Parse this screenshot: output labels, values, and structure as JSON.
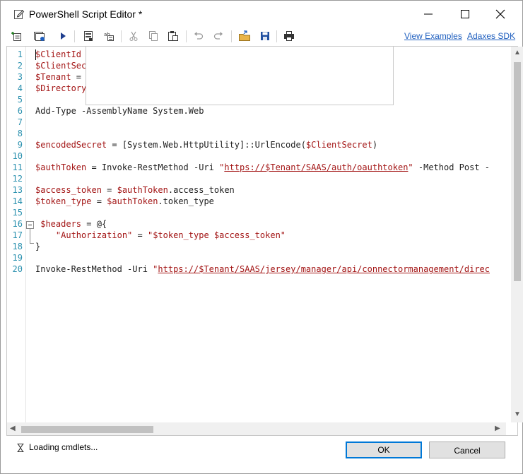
{
  "window": {
    "title": "PowerShell Script Editor *"
  },
  "toolbar": {
    "buttons": [
      {
        "icon": "insert-line-icon"
      },
      {
        "icon": "run-options-icon"
      },
      {
        "icon": "run-icon"
      },
      {
        "icon": "parameters-icon"
      },
      {
        "icon": "variables-icon"
      },
      {
        "icon": "cut-icon"
      },
      {
        "icon": "copy-icon"
      },
      {
        "icon": "paste-icon"
      },
      {
        "icon": "undo-icon"
      },
      {
        "icon": "redo-icon"
      },
      {
        "icon": "open-folder-icon"
      },
      {
        "icon": "save-icon"
      },
      {
        "icon": "print-icon"
      }
    ],
    "links": {
      "view_examples": "View Examples",
      "sdk": "Adaxes SDK"
    }
  },
  "editor": {
    "lines": [
      {
        "n": "1",
        "segs": [
          [
            "var",
            "$ClientId"
          ]
        ]
      },
      {
        "n": "2",
        "segs": [
          [
            "var",
            "$ClientSec"
          ]
        ]
      },
      {
        "n": "3",
        "segs": [
          [
            "var",
            "$Tenant"
          ],
          [
            "plain",
            " ="
          ]
        ]
      },
      {
        "n": "4",
        "segs": [
          [
            "var",
            "$Directory"
          ]
        ]
      },
      {
        "n": "5",
        "segs": []
      },
      {
        "n": "6",
        "segs": [
          [
            "plain",
            "Add-Type -AssemblyName System.Web"
          ]
        ]
      },
      {
        "n": "7",
        "segs": []
      },
      {
        "n": "8",
        "segs": []
      },
      {
        "n": "9",
        "segs": [
          [
            "var",
            "$encodedSecret"
          ],
          [
            "plain",
            " = [System.Web.HttpUtility]::UrlEncode("
          ],
          [
            "var",
            "$ClientSecret"
          ],
          [
            "plain",
            ")"
          ]
        ]
      },
      {
        "n": "10",
        "segs": []
      },
      {
        "n": "11",
        "segs": [
          [
            "var",
            "$authToken"
          ],
          [
            "plain",
            " = Invoke-RestMethod -Uri "
          ],
          [
            "str",
            "\""
          ],
          [
            "link",
            "https://$Tenant/SAAS/auth/oauthtoken"
          ],
          [
            "str",
            "\""
          ],
          [
            "plain",
            " -Method Post -"
          ]
        ]
      },
      {
        "n": "12",
        "segs": []
      },
      {
        "n": "13",
        "segs": [
          [
            "var",
            "$access_token"
          ],
          [
            "plain",
            " = "
          ],
          [
            "var",
            "$authToken"
          ],
          [
            "plain",
            ".access_token"
          ]
        ]
      },
      {
        "n": "14",
        "segs": [
          [
            "var",
            "$token_type"
          ],
          [
            "plain",
            " = "
          ],
          [
            "var",
            "$authToken"
          ],
          [
            "plain",
            ".token_type"
          ]
        ]
      },
      {
        "n": "15",
        "segs": []
      },
      {
        "n": "16",
        "segs": [
          [
            "plain",
            " "
          ],
          [
            "var",
            "$headers"
          ],
          [
            "plain",
            " = @{"
          ]
        ]
      },
      {
        "n": "17",
        "segs": [
          [
            "plain",
            "    "
          ],
          [
            "str",
            "\"Authorization\""
          ],
          [
            "plain",
            " = "
          ],
          [
            "str",
            "\"$token_type $access_token\""
          ]
        ]
      },
      {
        "n": "18",
        "segs": [
          [
            "plain",
            "}"
          ]
        ]
      },
      {
        "n": "19",
        "segs": []
      },
      {
        "n": "20",
        "segs": [
          [
            "plain",
            "Invoke-RestMethod -Uri "
          ],
          [
            "str",
            "\""
          ],
          [
            "link",
            "https://$Tenant/SAAS/jersey/manager/api/connectormanagement/direc"
          ]
        ]
      }
    ]
  },
  "status": {
    "text": "Loading cmdlets..."
  },
  "buttons": {
    "ok": "OK",
    "cancel": "Cancel"
  }
}
